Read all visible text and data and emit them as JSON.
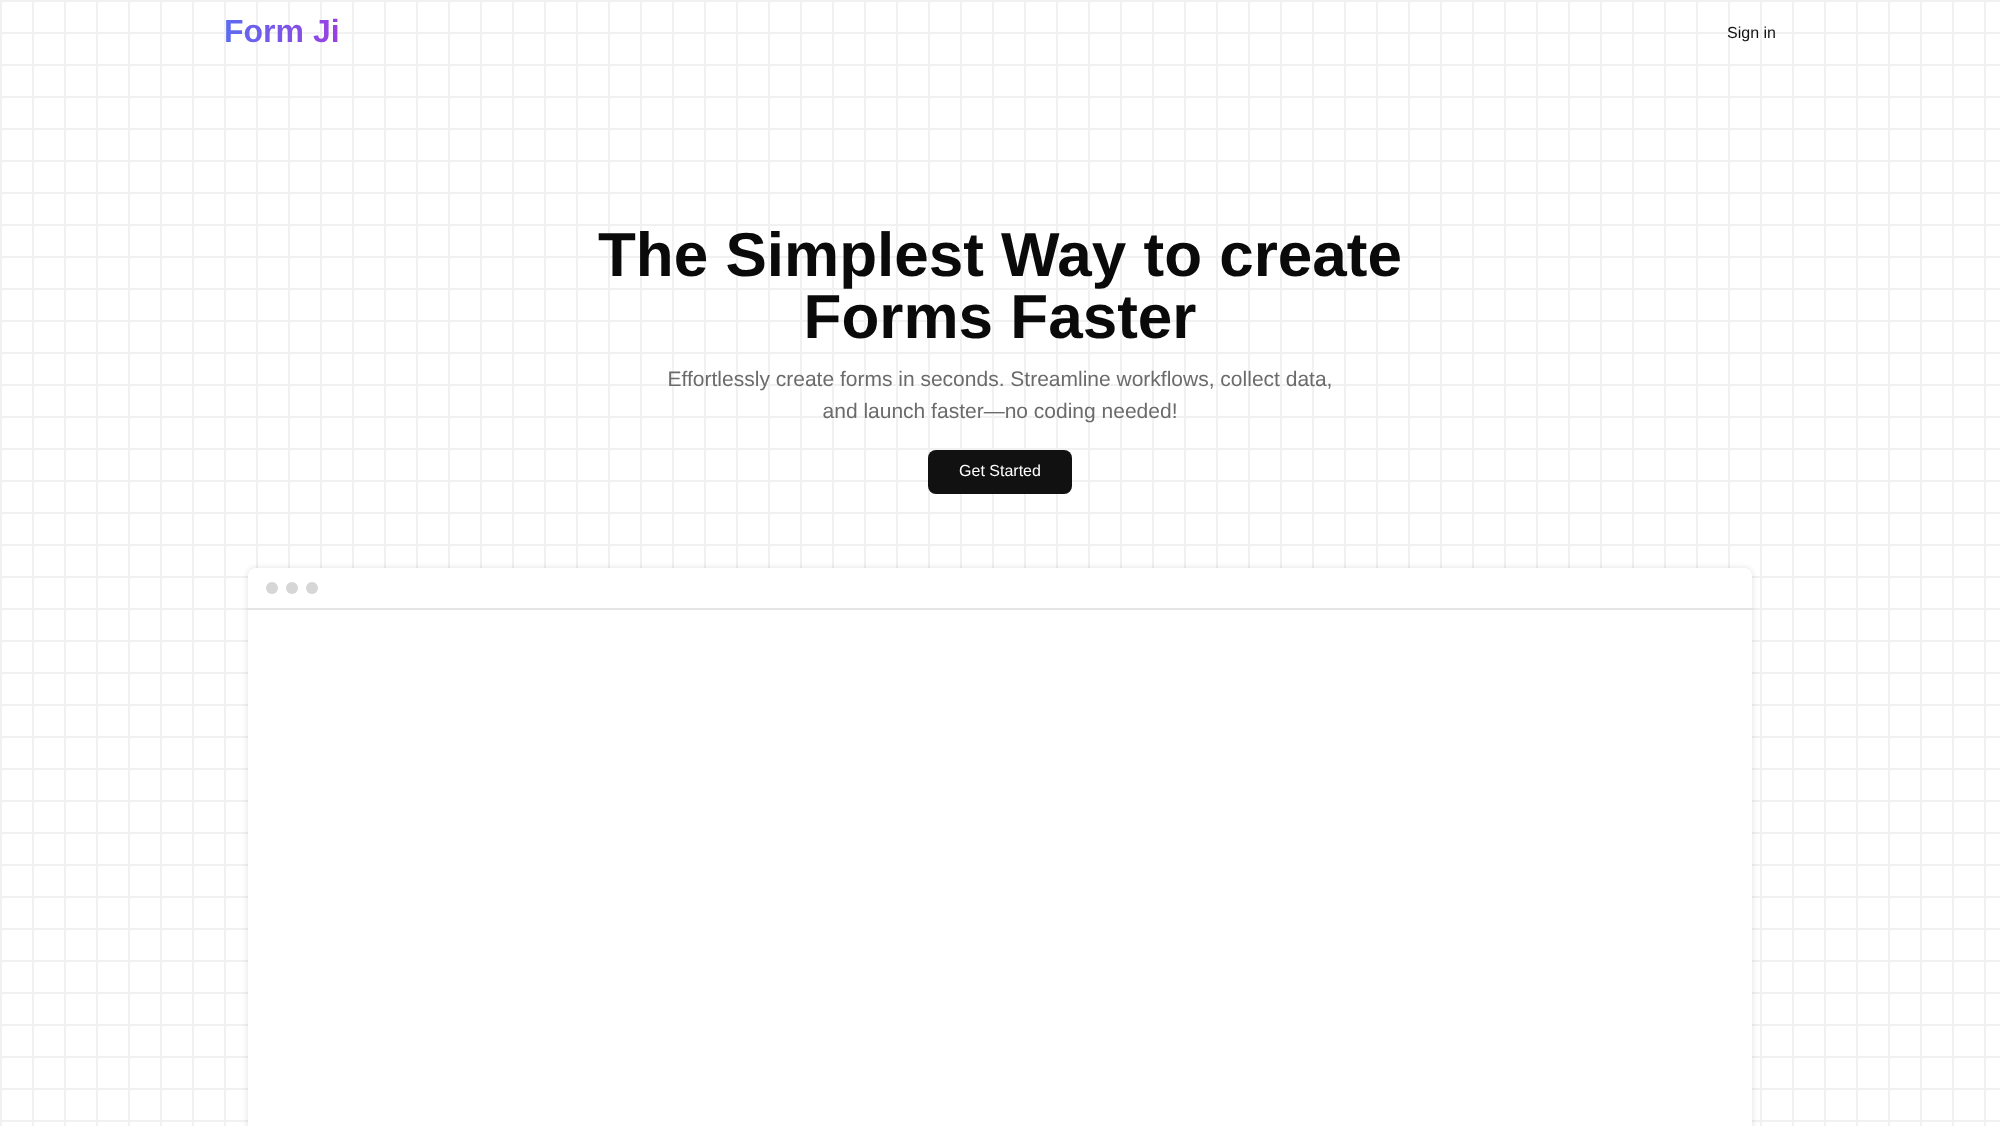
{
  "navbar": {
    "logo": "Form Ji",
    "sign_in": "Sign in"
  },
  "hero": {
    "title_lines": [
      "The Simplest Way to create",
      "Forms Faster"
    ],
    "subtitle_lines": [
      "Effortlessly create forms in seconds. Streamline workflows, collect data,",
      "and launch faster—no coding needed!"
    ],
    "cta": "Get Started"
  }
}
